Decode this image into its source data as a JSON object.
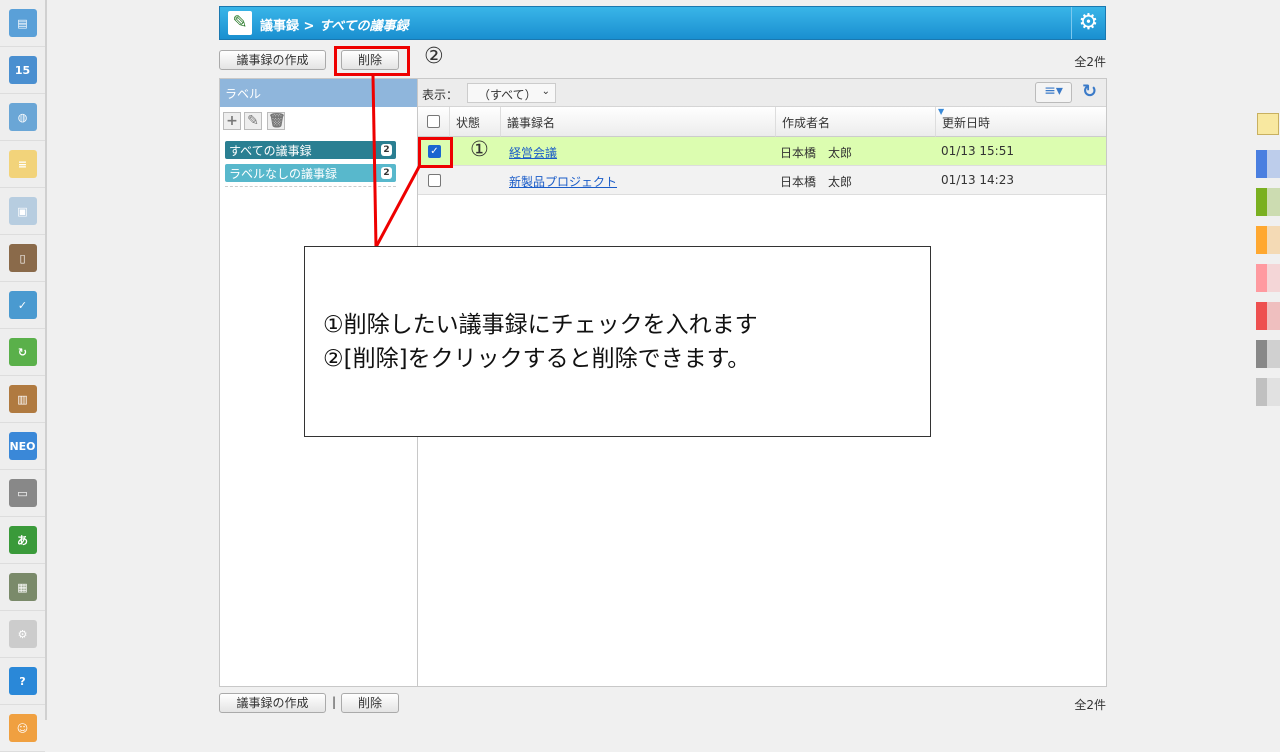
{
  "sidebar": {
    "items": [
      {
        "name": "portal",
        "color": "#5aa0d8",
        "glyph": "▤"
      },
      {
        "name": "schedule",
        "color": "#4a8fd0",
        "glyph": "15"
      },
      {
        "name": "facility",
        "color": "#6aa6d6",
        "glyph": "◍"
      },
      {
        "name": "memo",
        "color": "#f2d37a",
        "glyph": "≡"
      },
      {
        "name": "board",
        "color": "#b7cde0",
        "glyph": "▣"
      },
      {
        "name": "report",
        "color": "#8a6a4a",
        "glyph": "▯"
      },
      {
        "name": "workflow",
        "color": "#4a9ad0",
        "glyph": "✓"
      },
      {
        "name": "circular",
        "color": "#5ab04a",
        "glyph": "↻"
      },
      {
        "name": "cabinet",
        "color": "#b07a40",
        "glyph": "▥"
      },
      {
        "name": "neo",
        "color": "#3a88d8",
        "glyph": "NEO"
      },
      {
        "name": "folder",
        "color": "#888888",
        "glyph": "▭"
      },
      {
        "name": "app1",
        "color": "#3a9a3a",
        "glyph": "あ"
      },
      {
        "name": "app2",
        "color": "#7a8a6a",
        "glyph": "▦"
      },
      {
        "name": "settings",
        "color": "#cccccc",
        "glyph": "⚙"
      },
      {
        "name": "help",
        "color": "#2a88d8",
        "glyph": "?"
      },
      {
        "name": "support",
        "color": "#f0a040",
        "glyph": "☺"
      }
    ]
  },
  "header": {
    "app": "議事録",
    "separator": ">",
    "current": "すべての議事録",
    "gear_icon": "gear-icon"
  },
  "toolbar": {
    "create": "議事録の作成",
    "delete": "削除",
    "total": "全2件",
    "callout_num": "②"
  },
  "labels": {
    "title": "ラベル",
    "items": [
      {
        "label": "すべての議事録",
        "count": "2",
        "color": "#2a7f92"
      },
      {
        "label": "ラベルなしの議事録",
        "count": "2",
        "color": "#58b8cc"
      }
    ]
  },
  "list": {
    "display_label": "表示：",
    "filter": "（すべて）",
    "columns": [
      "状態",
      "議事録名",
      "作成者名",
      "更新日時"
    ],
    "rows": [
      {
        "checked": true,
        "marker": "①",
        "name": "経営会議",
        "author": "日本橋　太郎",
        "updated": "01/13 15:51"
      },
      {
        "checked": false,
        "marker": "",
        "name": "新製品プロジェクト",
        "author": "日本橋　太郎",
        "updated": "01/13 14:23"
      }
    ]
  },
  "callout": {
    "line1": "①削除したい議事録にチェックを入れます",
    "line2": "②[削除]をクリックすると削除できます。"
  },
  "footer": {
    "create": "議事録の作成",
    "sep": "|",
    "delete": "削除",
    "total": "全2件"
  },
  "palette": [
    "#4a7fe0",
    "#7ab020",
    "#ffa830",
    "#ff9aa0",
    "#ee5050",
    "#888888",
    "#c0c0c0"
  ],
  "colors": {
    "accent": "#1a8fd0",
    "selected_row": "#dcfdb0",
    "highlight": "#e00000"
  }
}
